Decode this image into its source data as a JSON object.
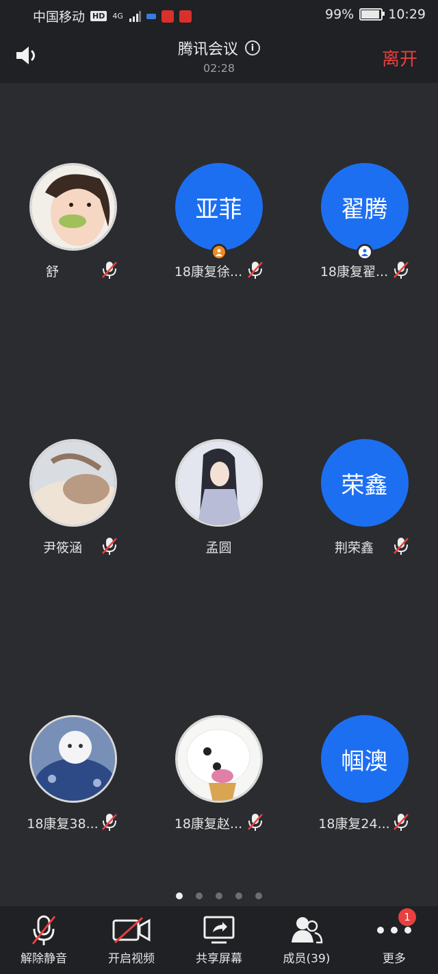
{
  "status_bar": {
    "carrier": "中国移动",
    "hd": "HD",
    "network": "4G",
    "battery": "99%",
    "battery_level": 0.99,
    "time": "10:29"
  },
  "header": {
    "title": "腾讯会议",
    "info_icon": "i",
    "timer": "02:28",
    "leave_label": "离开"
  },
  "participants": [
    {
      "name": "舒",
      "avatar": "photo",
      "muted": true
    },
    {
      "name": "18康复徐...",
      "avatar": "text",
      "initials": "亚菲",
      "muted": true,
      "host": "orange"
    },
    {
      "name": "18康复翟...",
      "avatar": "text",
      "initials": "翟腾",
      "muted": true,
      "host": "white"
    },
    {
      "name": "尹筱涵",
      "avatar": "photo",
      "muted": true
    },
    {
      "name": "孟圆",
      "avatar": "photo",
      "muted": false
    },
    {
      "name": "荆荣鑫",
      "avatar": "text",
      "initials": "荣鑫",
      "muted": true
    },
    {
      "name": "18康复38...",
      "avatar": "photo",
      "muted": true
    },
    {
      "name": "18康复赵...",
      "avatar": "photo",
      "muted": true
    },
    {
      "name": "18康复24...",
      "avatar": "text",
      "initials": "帼澳",
      "muted": true
    }
  ],
  "pagination": {
    "total": 5,
    "active": 1
  },
  "toolbar": {
    "unmute": "解除静音",
    "video": "开启视频",
    "share": "共享屏幕",
    "members": "成员(39)",
    "more": "更多",
    "more_badge": "1"
  },
  "colors": {
    "avatar_blue": "#1d6ff2",
    "leave_red": "#e8403e",
    "host_orange": "#f08a23",
    "mute_red": "#e8403e"
  }
}
